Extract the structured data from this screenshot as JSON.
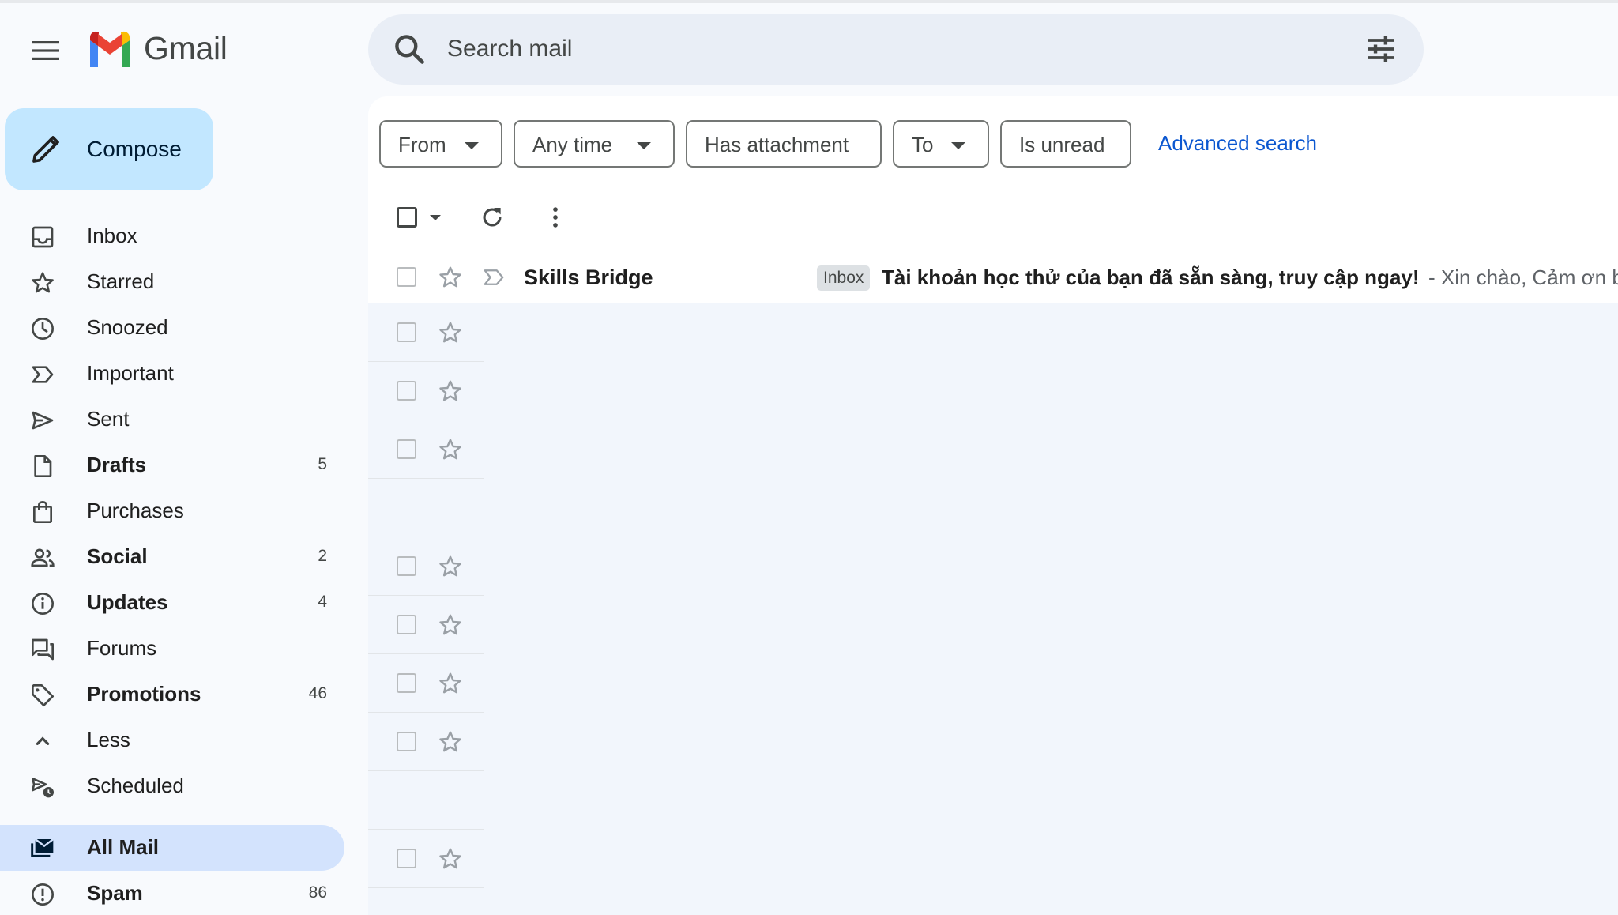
{
  "app": {
    "name": "Gmail"
  },
  "search": {
    "placeholder": "Search mail"
  },
  "compose": {
    "label": "Compose"
  },
  "sidebar": {
    "items": [
      {
        "label": "Inbox",
        "icon": "inbox-icon",
        "count": "",
        "bold": false
      },
      {
        "label": "Starred",
        "icon": "star-icon",
        "count": "",
        "bold": false
      },
      {
        "label": "Snoozed",
        "icon": "clock-icon",
        "count": "",
        "bold": false
      },
      {
        "label": "Important",
        "icon": "important-icon",
        "count": "",
        "bold": false
      },
      {
        "label": "Sent",
        "icon": "send-icon",
        "count": "",
        "bold": false
      },
      {
        "label": "Drafts",
        "icon": "draft-icon",
        "count": "5",
        "bold": true
      },
      {
        "label": "Purchases",
        "icon": "shopping-bag-icon",
        "count": "",
        "bold": false
      },
      {
        "label": "Social",
        "icon": "people-icon",
        "count": "2",
        "bold": true
      },
      {
        "label": "Updates",
        "icon": "info-icon",
        "count": "4",
        "bold": true
      },
      {
        "label": "Forums",
        "icon": "forum-icon",
        "count": "",
        "bold": false
      },
      {
        "label": "Promotions",
        "icon": "tag-icon",
        "count": "46",
        "bold": true
      },
      {
        "label": "Less",
        "icon": "chevron-up-icon",
        "count": "",
        "bold": false
      },
      {
        "label": "Scheduled",
        "icon": "scheduled-send-icon",
        "count": "",
        "bold": false
      },
      {
        "label": "All Mail",
        "icon": "all-mail-icon",
        "count": "",
        "bold": true,
        "active": true
      },
      {
        "label": "Spam",
        "icon": "spam-icon",
        "count": "86",
        "bold": true
      }
    ]
  },
  "filters": {
    "chips": [
      {
        "label": "From",
        "dropdown": true
      },
      {
        "label": "Any time",
        "dropdown": true
      },
      {
        "label": "Has attachment",
        "dropdown": false
      },
      {
        "label": "To",
        "dropdown": true
      },
      {
        "label": "Is unread",
        "dropdown": false
      }
    ],
    "advanced": "Advanced search"
  },
  "messages": [
    {
      "sender": "Skills Bridge",
      "label": "Inbox",
      "subject": "Tài khoản học thử của bạn đã sẵn sàng, truy cập ngay!",
      "snippet": " - Xin chào, Cảm ơn b"
    }
  ],
  "colors": {
    "accent": "#0b57d0",
    "compose_bg": "#c2e7ff",
    "active_nav": "#d3e3fd",
    "search_bg": "#e9eef6"
  }
}
